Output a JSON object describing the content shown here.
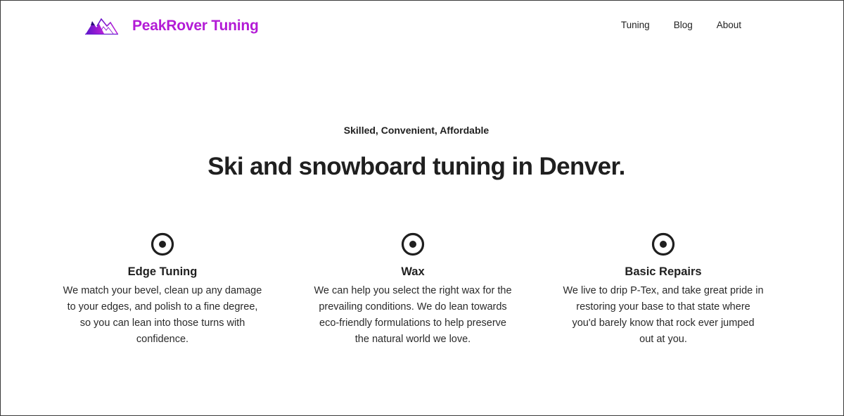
{
  "header": {
    "brand_name": "PeakRover Tuning",
    "brand_color": "#b31bd6",
    "logo_icon": "mountain-logo-icon",
    "nav": [
      {
        "label": "Tuning"
      },
      {
        "label": "Blog"
      },
      {
        "label": "About"
      }
    ]
  },
  "hero": {
    "eyebrow": "Skilled, Convenient, Affordable",
    "headline": "Ski and snowboard tuning in Denver."
  },
  "features": [
    {
      "icon": "radio-target-icon",
      "title": "Edge Tuning",
      "lines": [
        "We match your bevel, clean up any damage",
        "to your edges, and polish to a fine degree,",
        "so you can lean into those turns with",
        "confidence."
      ]
    },
    {
      "icon": "radio-target-icon",
      "title": "Wax",
      "lines": [
        "We can help you select the right wax for the",
        "prevailing conditions. We do lean towards",
        "eco-friendly formulations to help preserve",
        "the natural world we love."
      ]
    },
    {
      "icon": "radio-target-icon",
      "title": "Basic Repairs",
      "lines": [
        "We live to drip P-Tex, and take great pride in",
        "restoring your base to that state where",
        "you'd barely know that rock ever jumped",
        "out at you."
      ]
    }
  ]
}
